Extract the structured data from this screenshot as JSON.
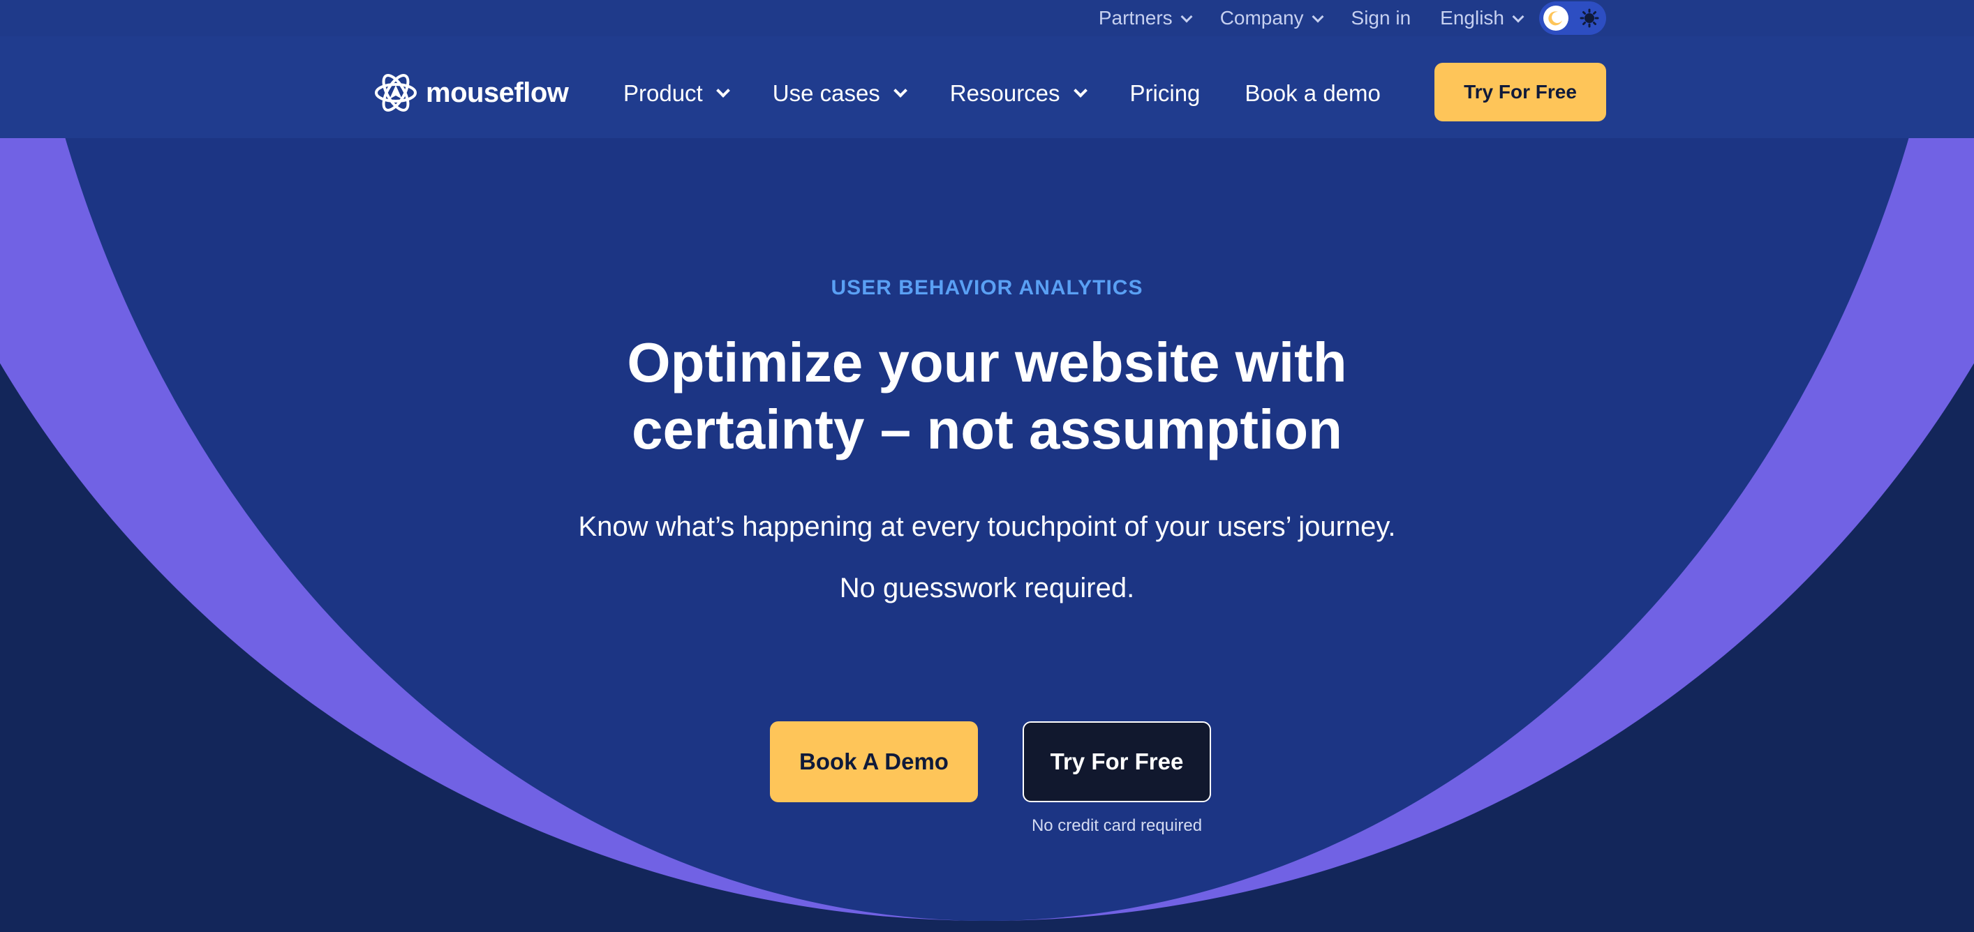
{
  "colors": {
    "page_bg": "#13265a",
    "hero_bg": "#1c3584",
    "ring": "#7162e4",
    "accent_yellow": "#fec559",
    "eyebrow_blue": "#5aa0f4"
  },
  "top_bar": {
    "partners": "Partners",
    "company": "Company",
    "sign_in": "Sign in",
    "language": "English",
    "theme_toggle": {
      "dark_icon": "moon-icon",
      "light_icon": "sun-icon",
      "state": "dark"
    }
  },
  "nav": {
    "logo_text": "mouseflow",
    "logo_icon": "mouseflow-logo-icon",
    "links": [
      {
        "label": "Product",
        "dropdown": true
      },
      {
        "label": "Use cases",
        "dropdown": true
      },
      {
        "label": "Resources",
        "dropdown": true
      },
      {
        "label": "Pricing",
        "dropdown": false
      },
      {
        "label": "Book a demo",
        "dropdown": false
      }
    ],
    "cta": "Try For Free"
  },
  "hero": {
    "eyebrow": "USER BEHAVIOR ANALYTICS",
    "title_line1": "Optimize your website with",
    "title_line2": "certainty – not assumption",
    "subtitle": "Know what’s happening at every touchpoint of your users’ journey.",
    "subtitle2": "No guesswork required.",
    "primary_button": "Book A Demo",
    "secondary_button": "Try For Free",
    "note": "No credit card required"
  }
}
